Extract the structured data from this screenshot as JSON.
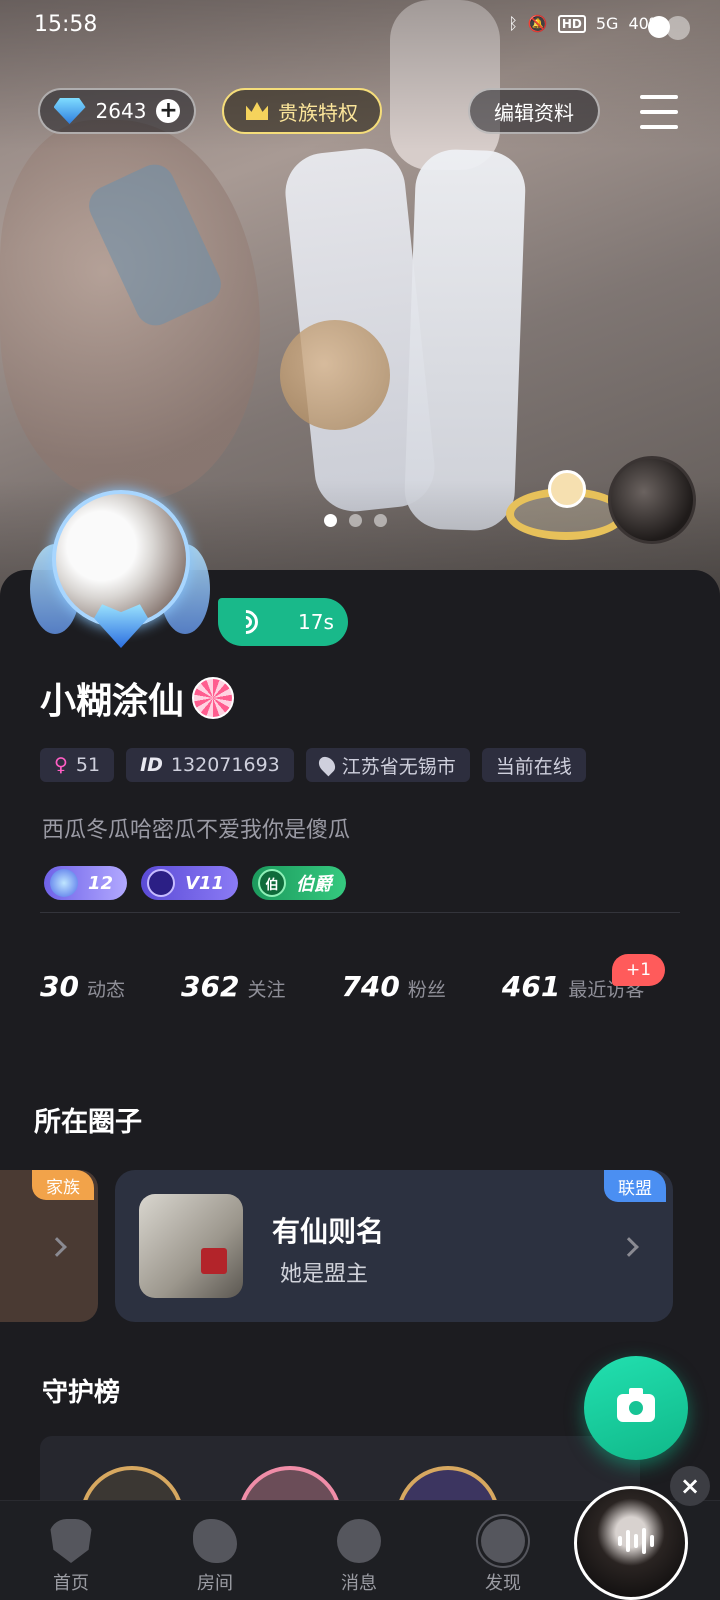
{
  "status_bar": {
    "time": "15:58",
    "network": "5G",
    "hd": "HD",
    "battery": "40%"
  },
  "top": {
    "diamonds": "2643",
    "vip_label": "贵族特权",
    "edit_label": "编辑资料"
  },
  "profile": {
    "live_duration": "17s",
    "name": "小糊涂仙",
    "tags": {
      "gender_age": "51",
      "id_label": "ID",
      "id": "132071693",
      "location": "江苏省无锡市",
      "online": "当前在线"
    },
    "signature": "西瓜冬瓜哈密瓜不爱我你是傻瓜",
    "levels": [
      "12",
      "V11",
      "伯爵"
    ],
    "level_badge_char": "伯"
  },
  "stats": [
    {
      "num": "30",
      "label": "动态"
    },
    {
      "num": "362",
      "label": "关注"
    },
    {
      "num": "740",
      "label": "粉丝"
    },
    {
      "num": "461",
      "label": "最近访客"
    }
  ],
  "visitor_badge": "+1",
  "circles": {
    "title": "所在圈子",
    "family_tag": "家族",
    "alliance": {
      "tag": "联盟",
      "name": "有仙则名",
      "role": "她是盟主"
    }
  },
  "guard": {
    "title": "守护榜"
  },
  "nav": [
    {
      "label": "首页",
      "icon": "mask-icon"
    },
    {
      "label": "房间",
      "icon": "room-icon"
    },
    {
      "label": "消息",
      "icon": "message-icon"
    },
    {
      "label": "发现",
      "icon": "planet-icon"
    }
  ],
  "colors": {
    "accent": "#19b98a",
    "vip": "#f5dd7a",
    "badge_red": "#ff5b5b",
    "alliance_blue": "#4b8ff2",
    "family_orange": "#f2a34a"
  }
}
